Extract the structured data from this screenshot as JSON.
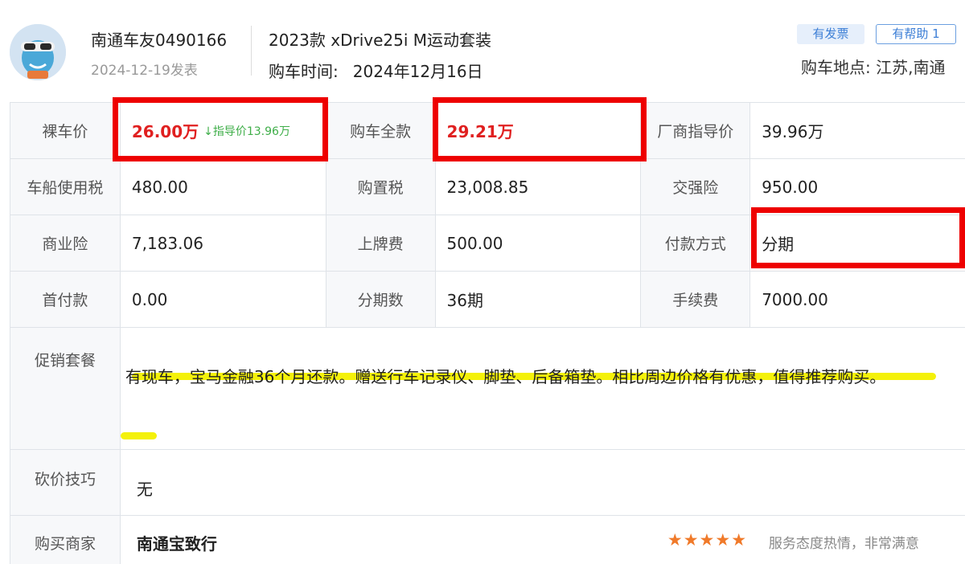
{
  "header": {
    "user_name": "南通车友0490166",
    "post_date": "2024-12-19发表",
    "car_model": "2023款 xDrive25i M运动套装",
    "buy_time_label": "购车时间:",
    "buy_time_value": "2024年12月16日",
    "badge_invoice": "有发票",
    "badge_helpful": "有帮助 1",
    "location": "购车地点: 江苏,南通"
  },
  "table": {
    "rows": [
      [
        {
          "label": "裸车价",
          "value": "26.00万",
          "sub": "↓指导价13.96万"
        },
        {
          "label": "购车全款",
          "value": "29.21万"
        },
        {
          "label": "厂商指导价",
          "value": "39.96万"
        }
      ],
      [
        {
          "label": "车船使用税",
          "value": "480.00"
        },
        {
          "label": "购置税",
          "value": "23,008.85"
        },
        {
          "label": "交强险",
          "value": "950.00"
        }
      ],
      [
        {
          "label": "商业险",
          "value": "7,183.06"
        },
        {
          "label": "上牌费",
          "value": "500.00"
        },
        {
          "label": "付款方式",
          "value": "分期"
        }
      ],
      [
        {
          "label": "首付款",
          "value": "0.00"
        },
        {
          "label": "分期数",
          "value": "36期"
        },
        {
          "label": "手续费",
          "value": "7000.00"
        }
      ]
    ],
    "promo_label": "促销套餐",
    "promo_text": "有现车，宝马金融36个月还款。赠送行车记录仪、脚垫、后备箱垫。相比周边价格有优惠，值得推荐购买。",
    "bargain_label": "砍价技巧",
    "bargain_text": "无",
    "dealer_label": "购买商家",
    "dealer_name": "南通宝致行",
    "dealer_rating": 5,
    "dealer_service": "服务态度热情，非常满意"
  },
  "colors": {
    "highlight_red": "#ee0000",
    "highlight_yellow": "#f4f10a",
    "price_red": "#e02020",
    "guide_green": "#3fae49",
    "star_orange": "#f07a2a"
  }
}
